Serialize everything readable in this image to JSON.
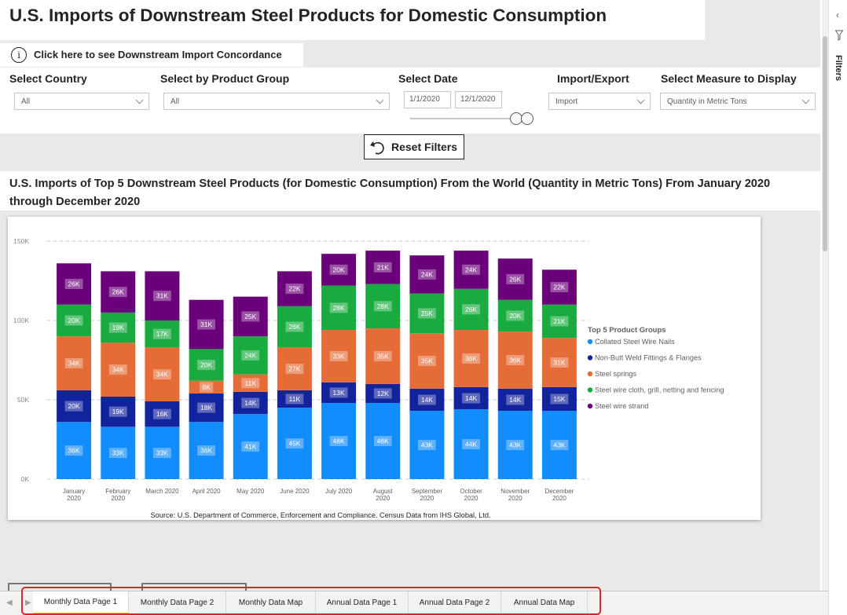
{
  "header": {
    "title": "U.S. Imports of Downstream Steel Products for Domestic Consumption",
    "info_icon": "info-icon",
    "concordance_link": "Click here to see Downstream Import Concordance"
  },
  "slicers": {
    "country": {
      "label": "Select Country",
      "value": "All"
    },
    "product_group": {
      "label": "Select by Product Group",
      "value": "All"
    },
    "date": {
      "label": "Select Date",
      "start": "1/1/2020",
      "end": "12/1/2020"
    },
    "import_export": {
      "label": "Import/Export",
      "value": "Import"
    },
    "measure": {
      "label": "Select Measure to Display",
      "value": "Quantity in Metric Tons"
    }
  },
  "reset_button": {
    "label": "Reset Filters",
    "icon": "undo-icon"
  },
  "chart_title": "U.S. Imports of Top 5 Downstream Steel Products (for Domestic Consumption) From the World (Quantity in Metric Tons) From January 2020 through December 2020",
  "chart_data": {
    "type": "bar",
    "stacked": true,
    "categories": [
      "January 2020",
      "February 2020",
      "March 2020",
      "April 2020",
      "May 2020",
      "June 2020",
      "July 2020",
      "August 2020",
      "September 2020",
      "October 2020",
      "November 2020",
      "December 2020"
    ],
    "series": [
      {
        "name": "Collated Steel Wire Nails",
        "color": "#118dff",
        "values": [
          36,
          33,
          33,
          36,
          41,
          45,
          48,
          48,
          43,
          44,
          43,
          43
        ]
      },
      {
        "name": "Non-Butt Weld Fittings & Flanges",
        "color": "#12239e",
        "values": [
          20,
          19,
          16,
          18,
          14,
          11,
          13,
          12,
          14,
          14,
          14,
          15
        ]
      },
      {
        "name": "Steel springs",
        "color": "#e66c37",
        "values": [
          34,
          34,
          34,
          8,
          11,
          27,
          33,
          35,
          35,
          36,
          36,
          31
        ]
      },
      {
        "name": "Steel wire cloth, grill, netting and fencing",
        "color": "#1aab40",
        "values": [
          20,
          19,
          17,
          20,
          24,
          26,
          28,
          28,
          25,
          26,
          20,
          21
        ]
      },
      {
        "name": "Steel wire strand",
        "color": "#6b007b",
        "values": [
          26,
          26,
          31,
          31,
          25,
          22,
          20,
          21,
          24,
          24,
          26,
          22
        ]
      }
    ],
    "data_labels": [
      [
        "36K",
        "33K",
        "33K",
        "36K",
        "41K",
        "45K",
        "48K",
        "48K",
        "43K",
        "44K",
        "43K",
        "43K"
      ],
      [
        "20K",
        "19K",
        "16K",
        "18K",
        "14K",
        "11K",
        "13K",
        "12K",
        "14K",
        "14K",
        "14K",
        "15K"
      ],
      [
        "34K",
        "34K",
        "34K",
        "8K",
        "11K",
        "27K",
        "33K",
        "35K",
        "35K",
        "36K",
        "36K",
        "31K"
      ],
      [
        "20K",
        "19K",
        "17K",
        "20K",
        "24K",
        "26K",
        "28K",
        "28K",
        "25K",
        "26K",
        "20K",
        "21K"
      ],
      [
        "26K",
        "26K",
        "31K",
        "31K",
        "25K",
        "22K",
        "20K",
        "21K",
        "24K",
        "24K",
        "26K",
        "22K"
      ]
    ],
    "x_tick_labels": [
      [
        "January",
        "2020"
      ],
      [
        "February",
        "2020"
      ],
      [
        "March 2020"
      ],
      [
        "April 2020"
      ],
      [
        "May 2020"
      ],
      [
        "June 2020"
      ],
      [
        "July 2020"
      ],
      [
        "August",
        "2020"
      ],
      [
        "September",
        "2020"
      ],
      [
        "October",
        "2020"
      ],
      [
        "November",
        "2020"
      ],
      [
        "December",
        "2020"
      ]
    ],
    "y_unit": "thousand metric tons",
    "y_ticks": [
      0,
      50,
      100,
      150
    ],
    "y_tick_labels": [
      "0K",
      "50K",
      "100K",
      "150K"
    ],
    "ylim": [
      0,
      150
    ],
    "gridlines": "dashed",
    "legend_title": "Top 5 Product Groups",
    "legend_position": "right",
    "source": "Source: U.S. Department of Commerce, Enforcement and Compliance. Census Data from IHS Global, Ltd."
  },
  "filters_pane": {
    "label": "Filters",
    "icon": "funnel-icon",
    "collapse_icon": "chevron-left-icon"
  },
  "tabs": [
    {
      "label": "Monthly Data Page 1",
      "active": true
    },
    {
      "label": "Monthly Data Page 2",
      "active": false
    },
    {
      "label": "Monthly Data Map",
      "active": false
    },
    {
      "label": "Annual Data Page 1",
      "active": false
    },
    {
      "label": "Annual Data Page 2",
      "active": false
    },
    {
      "label": "Annual Data Map",
      "active": false
    }
  ],
  "colors": {
    "highlight_outline": "#d4282c",
    "active_tab_underline": "#f2c811"
  }
}
